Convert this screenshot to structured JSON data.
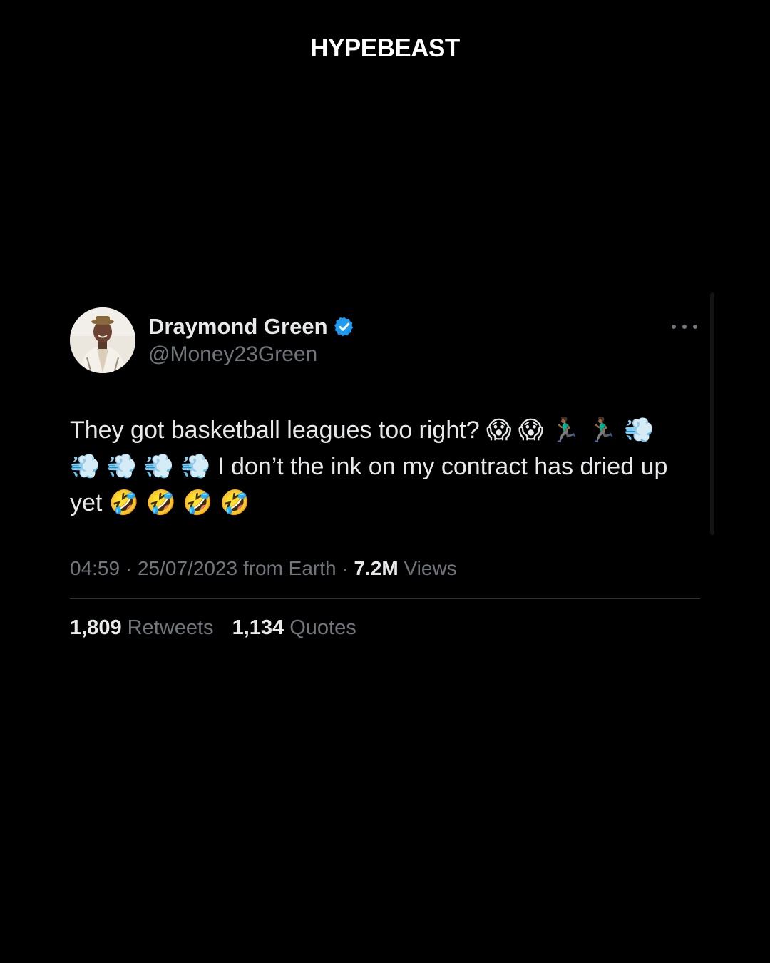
{
  "brand": {
    "logo_text": "HYPEBEAST"
  },
  "tweet": {
    "author": {
      "display_name": "Draymond Green",
      "handle": "@Money23Green",
      "verified": true
    },
    "text": "They got basketball leagues too right? 😱 😱 🏃🏾‍♂️ 🏃🏾‍♂️ 💨\n💨 💨 💨 💨 I don’t the ink on my contract has dried up\nyet 🤣 🤣 🤣 🤣",
    "time": "04:59",
    "separator": "·",
    "date": "25/07/2023",
    "source": "from Earth",
    "views_count": "7.2M",
    "views_label": "Views",
    "stats": {
      "retweets_count": "1,809",
      "retweets_label": "Retweets",
      "quotes_count": "1,134",
      "quotes_label": "Quotes"
    }
  },
  "colors": {
    "background": "#000000",
    "primary_text": "#e7e9ea",
    "secondary_text": "#71767b",
    "verified_badge": "#1d9bf0",
    "divider": "#2f3336"
  },
  "icons": {
    "verified": "verified-badge-icon",
    "more": "more-options-icon"
  }
}
